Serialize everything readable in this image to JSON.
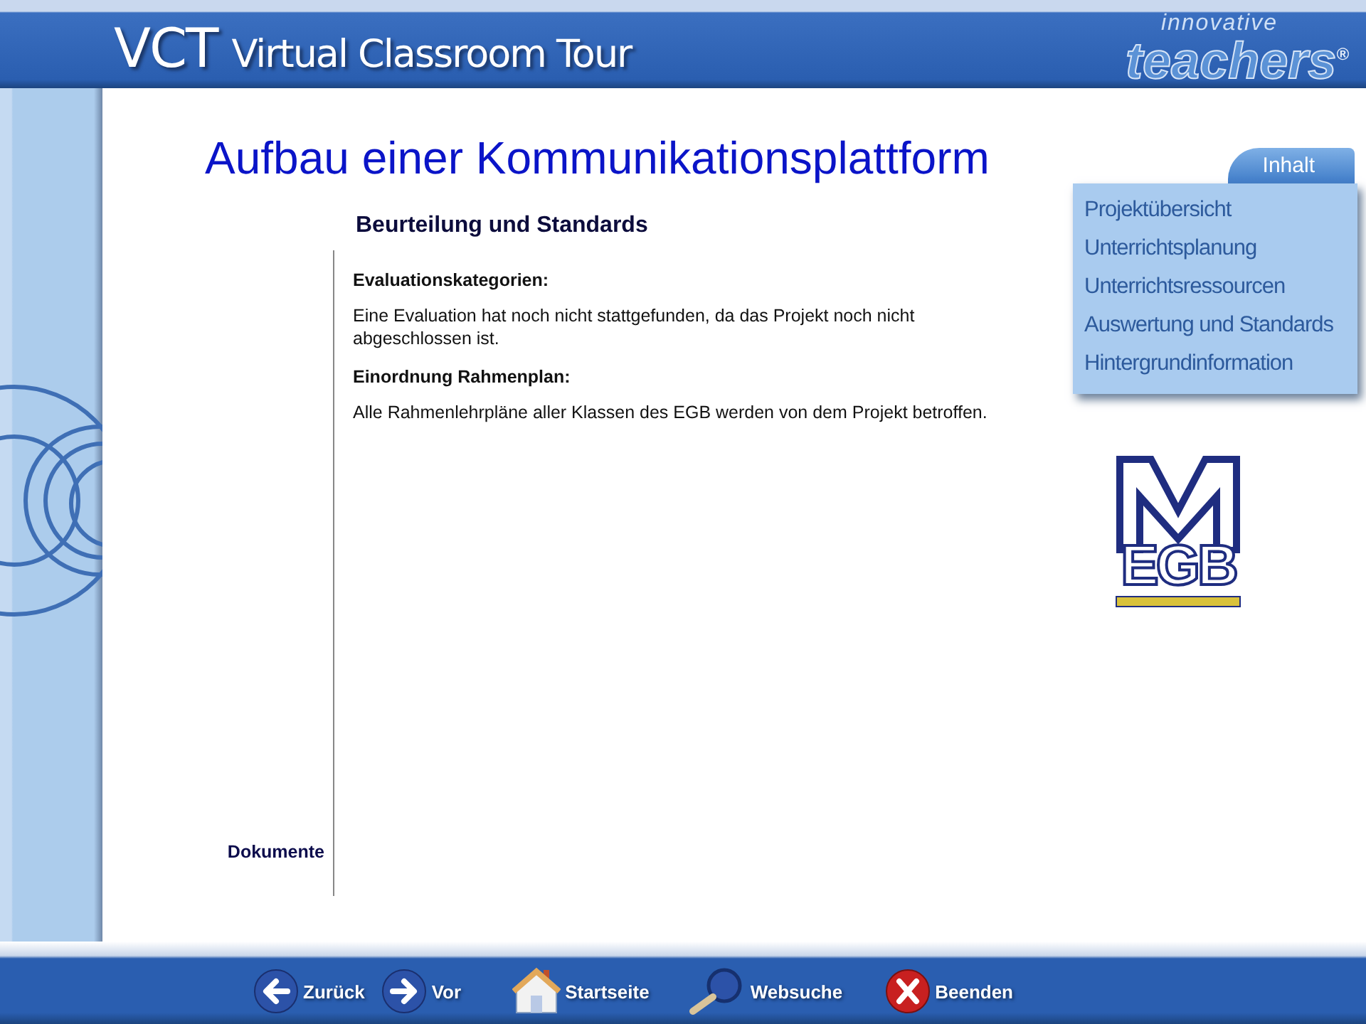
{
  "header": {
    "abbr": "VCT",
    "title": "Virtual Classroom Tour",
    "brand_top": "innovative",
    "brand": "teachers",
    "brand_mark": "®"
  },
  "page_title": "Aufbau einer Kommunikationsplattform",
  "section_title": "Beurteilung und Standards",
  "blocks": [
    {
      "heading": "Evaluationskategorien:",
      "text": "Eine Evaluation hat noch nicht stattgefunden, da das Projekt noch nicht abgeschlossen ist."
    },
    {
      "heading": "Einordnung Rahmenplan:",
      "text": "Alle Rahmenlehrpläne aller Klassen des EGB werden von dem Projekt betroffen."
    }
  ],
  "docs_label": "Dokumente",
  "menu": {
    "tab": "Inhalt",
    "items": [
      "Projektübersicht",
      "Unterrichtsplanung",
      "Unterrichtsressourcen",
      "Auswertung und Standards",
      "Hintergrundinformation"
    ]
  },
  "school_logo": {
    "text": "EGB"
  },
  "nav": [
    {
      "kind": "back",
      "label": "Zurück"
    },
    {
      "kind": "forward",
      "label": "Vor"
    },
    {
      "kind": "home",
      "label": "Startseite"
    },
    {
      "kind": "search",
      "label": "Websuche"
    },
    {
      "kind": "exit",
      "label": "Beenden"
    }
  ]
}
